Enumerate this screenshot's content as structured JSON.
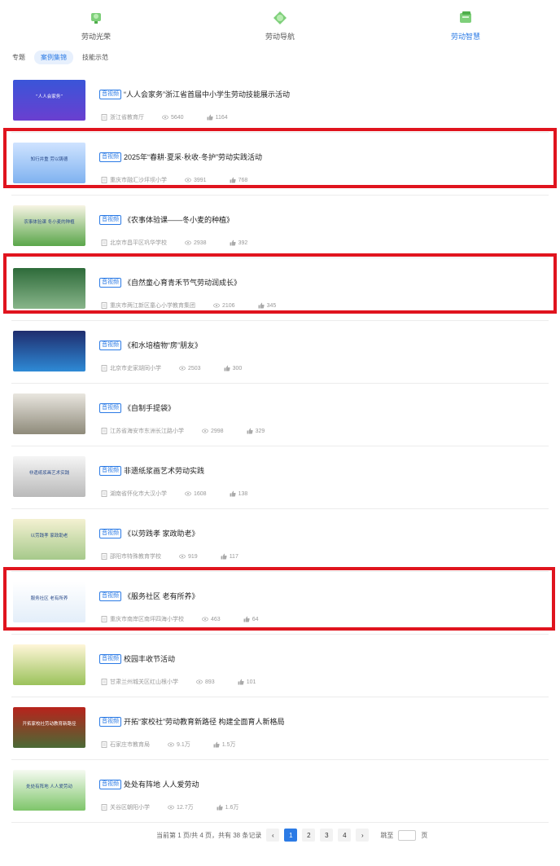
{
  "nav": {
    "items": [
      {
        "label": "劳动光荣",
        "icon": "trophy-icon",
        "active": false
      },
      {
        "label": "劳动导航",
        "icon": "compass-icon",
        "active": false
      },
      {
        "label": "劳动智慧",
        "icon": "book-icon",
        "active": true
      }
    ]
  },
  "subtabs": [
    {
      "label": "专题",
      "active": false
    },
    {
      "label": "案例集锦",
      "active": true
    },
    {
      "label": "技能示范",
      "active": false
    }
  ],
  "colors": {
    "accent": "#2c7be5",
    "highlight": "#e0141e"
  },
  "items": [
    {
      "badge": "音视频",
      "title": "“人人会家务”浙江省首届中小学生劳动技能展示活动",
      "school": "浙江省教育厅",
      "views": "5640",
      "likes": "1164",
      "thumb": "blue",
      "thumb_text": "“人人会家务”"
    },
    {
      "badge": "音视频",
      "title": "2025年“春耕·夏采·秋收·冬护”劳动实践活动",
      "school": "重庆市融汇沙坪坝小学",
      "views": "3991",
      "likes": "768",
      "thumb": "lightblue",
      "thumb_text": "知行并重 劳以铸德"
    },
    {
      "badge": "音视频",
      "title": "《农事体验课——冬小麦的种植》",
      "school": "北京市昌平区巩华学校",
      "views": "2938",
      "likes": "392",
      "thumb": "field",
      "thumb_text": "农事体验课 冬小麦的种植"
    },
    {
      "badge": "音视频",
      "title": "《自然童心育青禾节气劳动润成长》",
      "school": "重庆市两江新区童心小学教育集团",
      "views": "2106",
      "likes": "345",
      "thumb": "green",
      "thumb_text": ""
    },
    {
      "badge": "音视频",
      "title": "《和水培植物“房”朋友》",
      "school": "北京市史家胡同小学",
      "views": "2503",
      "likes": "300",
      "thumb": "classroom",
      "thumb_text": ""
    },
    {
      "badge": "音视频",
      "title": "《自制手提袋》",
      "school": "江苏省海安市东洲长江路小学",
      "views": "2998",
      "likes": "329",
      "thumb": "hall",
      "thumb_text": ""
    },
    {
      "badge": "音视频",
      "title": "非遗纸浆画艺术劳动实践",
      "school": "湖南省怀化市大汉小学",
      "views": "1608",
      "likes": "138",
      "thumb": "ink",
      "thumb_text": "非遗纸浆画艺术实践"
    },
    {
      "badge": "音视频",
      "title": "《以劳践孝 家政助老》",
      "school": "邵阳市特殊教育学校",
      "views": "919",
      "likes": "117",
      "thumb": "landscape",
      "thumb_text": "以劳践孝 家政助老"
    },
    {
      "badge": "音视频",
      "title": "《服务社区 老有所养》",
      "school": "重庆市南岸区南坪四海小学校",
      "views": "463",
      "likes": "64",
      "thumb": "white",
      "thumb_text": "服务社区 老有所养"
    },
    {
      "badge": "音视频",
      "title": "校园丰收节活动",
      "school": "甘肃兰州城关区红山根小学",
      "views": "893",
      "likes": "101",
      "thumb": "wheat",
      "thumb_text": ""
    },
    {
      "badge": "音视频",
      "title": "开拓“家校社”劳动教育新路径 构建全面育人新格局",
      "school": "石家庄市教育局",
      "views": "9.1万",
      "likes": "1.5万",
      "thumb": "red",
      "thumb_text": "开拓家校社劳动教育新路径"
    },
    {
      "badge": "音视频",
      "title": "处处有阵地 人人爱劳动",
      "school": "关谷区朝阳小学",
      "views": "12.7万",
      "likes": "1.6万",
      "thumb": "greenlight",
      "thumb_text": "处处有阵地 人人爱劳动"
    }
  ],
  "highlighted_rows": [
    1,
    3,
    8
  ],
  "pager": {
    "summary": "当前第 1 页/共 4 页，共有 38 条记录",
    "pages": [
      "1",
      "2",
      "3",
      "4"
    ],
    "current": "1",
    "prev": "‹",
    "next": "›",
    "jump_label": "跳至",
    "page_unit": "页"
  }
}
